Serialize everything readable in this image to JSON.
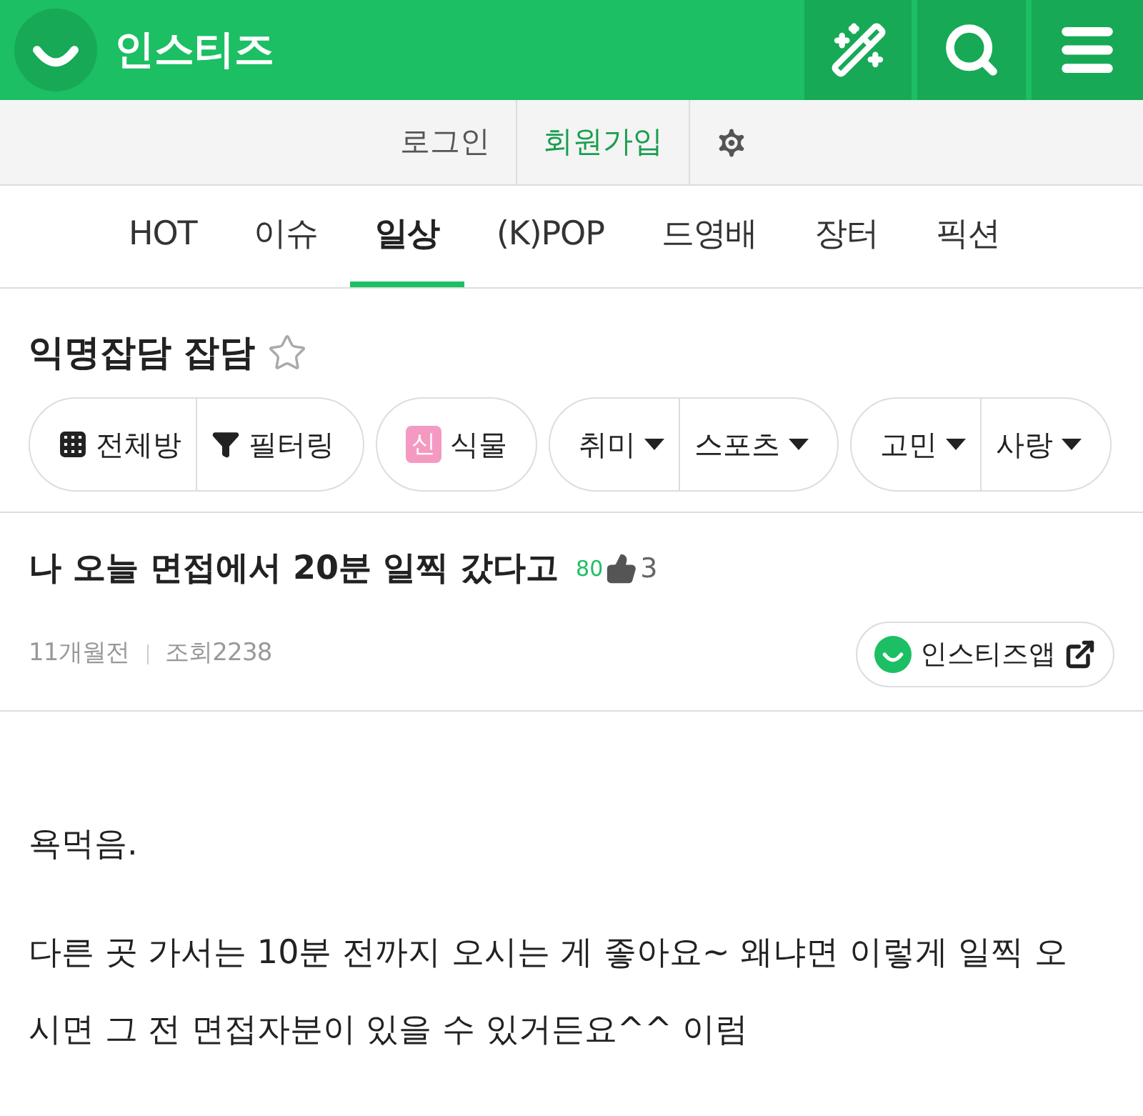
{
  "header": {
    "logo_text": "인스티즈"
  },
  "account_links": [
    {
      "label": "로그인",
      "kind": "plain"
    },
    {
      "label": "회원가입",
      "kind": "accent"
    }
  ],
  "tabs": [
    {
      "label": "HOT",
      "selected": false
    },
    {
      "label": "이슈",
      "selected": false
    },
    {
      "label": "일상",
      "selected": true
    },
    {
      "label": "(K)POP",
      "selected": false
    },
    {
      "label": "드영배",
      "selected": false
    },
    {
      "label": "장터",
      "selected": false
    },
    {
      "label": "픽션",
      "selected": false
    }
  ],
  "board": {
    "title": "익명잡담 잡담",
    "favorite": false
  },
  "chip_groups": [
    [
      {
        "label": "전체방",
        "kind": "grid"
      },
      {
        "label": "필터링",
        "kind": "filter"
      }
    ],
    [
      {
        "label": "식물",
        "kind": "badge",
        "badge": "신"
      }
    ],
    [
      {
        "label": "취미",
        "kind": "dropdown"
      },
      {
        "label": "스포츠",
        "kind": "dropdown"
      }
    ],
    [
      {
        "label": "고민",
        "kind": "dropdown"
      },
      {
        "label": "사랑",
        "kind": "dropdown"
      }
    ]
  ],
  "post": {
    "title": "나 오늘 면접에서 20분 일찍 갔다고",
    "comments": "80",
    "likes": "3",
    "time": "11개월전",
    "views": "조회2238",
    "app_button": "인스티즈앱",
    "paragraphs": [
      "욕먹음.",
      "다른 곳 가서는 10분 전까지 오시는 게 좋아요~ 왜냐면 이렇게 일찍 오시면 그 전 면접자분이 있을 수 있거든요^^ 이럼"
    ]
  }
}
